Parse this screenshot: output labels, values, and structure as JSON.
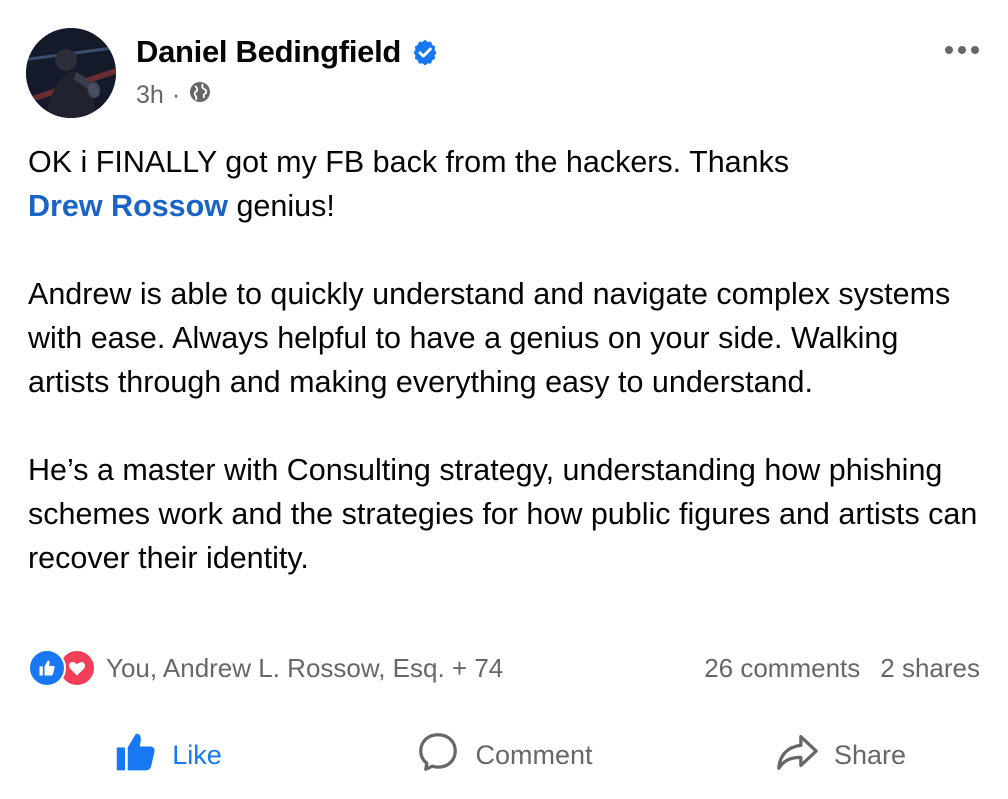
{
  "post": {
    "author": "Daniel Bedingfield",
    "time": "3h",
    "separator": "·",
    "body": {
      "line1_text": "OK i FINALLY got my FB back from the hackers. Thanks",
      "mention": "Drew Rossow",
      "line2_text": " genius!",
      "paragraph2": "Andrew is able to quickly understand and navigate complex systems with ease. Always helpful to have a genius on your side. Walking artists through and making everything easy to understand.",
      "paragraph3": "He’s a master with Consulting strategy, understanding how phishing schemes work and the strategies for how public figures and artists can recover their identity."
    }
  },
  "reactions": {
    "summary": "You, Andrew L. Rossow, Esq. + 74",
    "comments": "26 comments",
    "shares": "2 shares",
    "icons": [
      "like-icon",
      "love-icon"
    ]
  },
  "actions": {
    "like": "Like",
    "comment": "Comment",
    "share": "Share"
  },
  "colors": {
    "accent": "#1877f2",
    "mention": "#1a64c8",
    "love": "#f33e58",
    "secondary_text": "#65676b"
  }
}
